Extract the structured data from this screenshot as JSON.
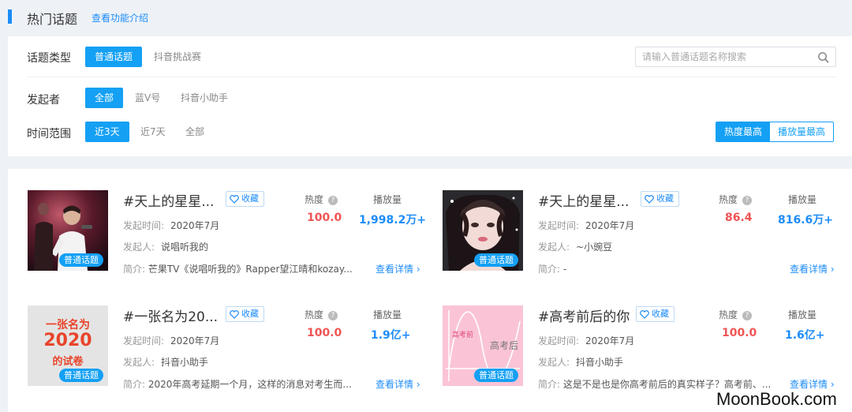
{
  "header": {
    "title": "热门话题",
    "feature_link": "查看功能介绍"
  },
  "filters": {
    "topic_type": {
      "label": "话题类型",
      "options": [
        "普通话题",
        "抖音挑战赛"
      ],
      "selected": "普通话题"
    },
    "initiator": {
      "label": "发起者",
      "options": [
        "全部",
        "蓝V号",
        "抖音小助手"
      ],
      "selected": "全部"
    },
    "time_range": {
      "label": "时间范围",
      "options": [
        "近3天",
        "近7天",
        "全部"
      ],
      "selected": "近3天"
    },
    "search": {
      "placeholder": "请输入普通话题名称搜索",
      "value": ""
    },
    "sort": {
      "options": [
        "热度最高",
        "播放量最高"
      ],
      "selected": "热度最高"
    }
  },
  "labels": {
    "heat": "热度",
    "plays": "播放量",
    "fav": "收藏",
    "detail": "查看详情",
    "launch_time": "发起时间:",
    "initiator": "发起人:",
    "intro": "简介:",
    "tag": "普通话题"
  },
  "topics": [
    {
      "title": "#天上的星星...",
      "launch_time": "2020年7月",
      "initiator": "说唱听我的",
      "intro": "芒果TV《说唱听我的》Rapper望江晴和kozay...",
      "heat": "100.0",
      "plays": "1,998.2万+"
    },
    {
      "title": "#天上的星星...",
      "launch_time": "2020年7月",
      "initiator": "~小豌豆",
      "intro": "-",
      "heat": "86.4",
      "plays": "816.6万+"
    },
    {
      "title": "#一张名为20...",
      "launch_time": "2020年7月",
      "initiator": "抖音小助手",
      "intro": "2020年高考延期一个月，这样的消息对考生而...",
      "heat": "100.0",
      "plays": "1.9亿+",
      "thumb_text": [
        "一张名为",
        "2020",
        "的试卷"
      ]
    },
    {
      "title": "#高考前后的你",
      "launch_time": "2020年7月",
      "initiator": "抖音小助手",
      "intro": "这是不是也是你高考前后的真实样子？高考前、...",
      "heat": "100.0",
      "plays": "1.6亿+",
      "thumb_text": [
        "高考前",
        "高考后"
      ]
    }
  ],
  "watermark": "MoonBook.com",
  "colors": {
    "accent": "#14a0f4",
    "heat": "#f05454",
    "link": "#1d8cf8"
  }
}
